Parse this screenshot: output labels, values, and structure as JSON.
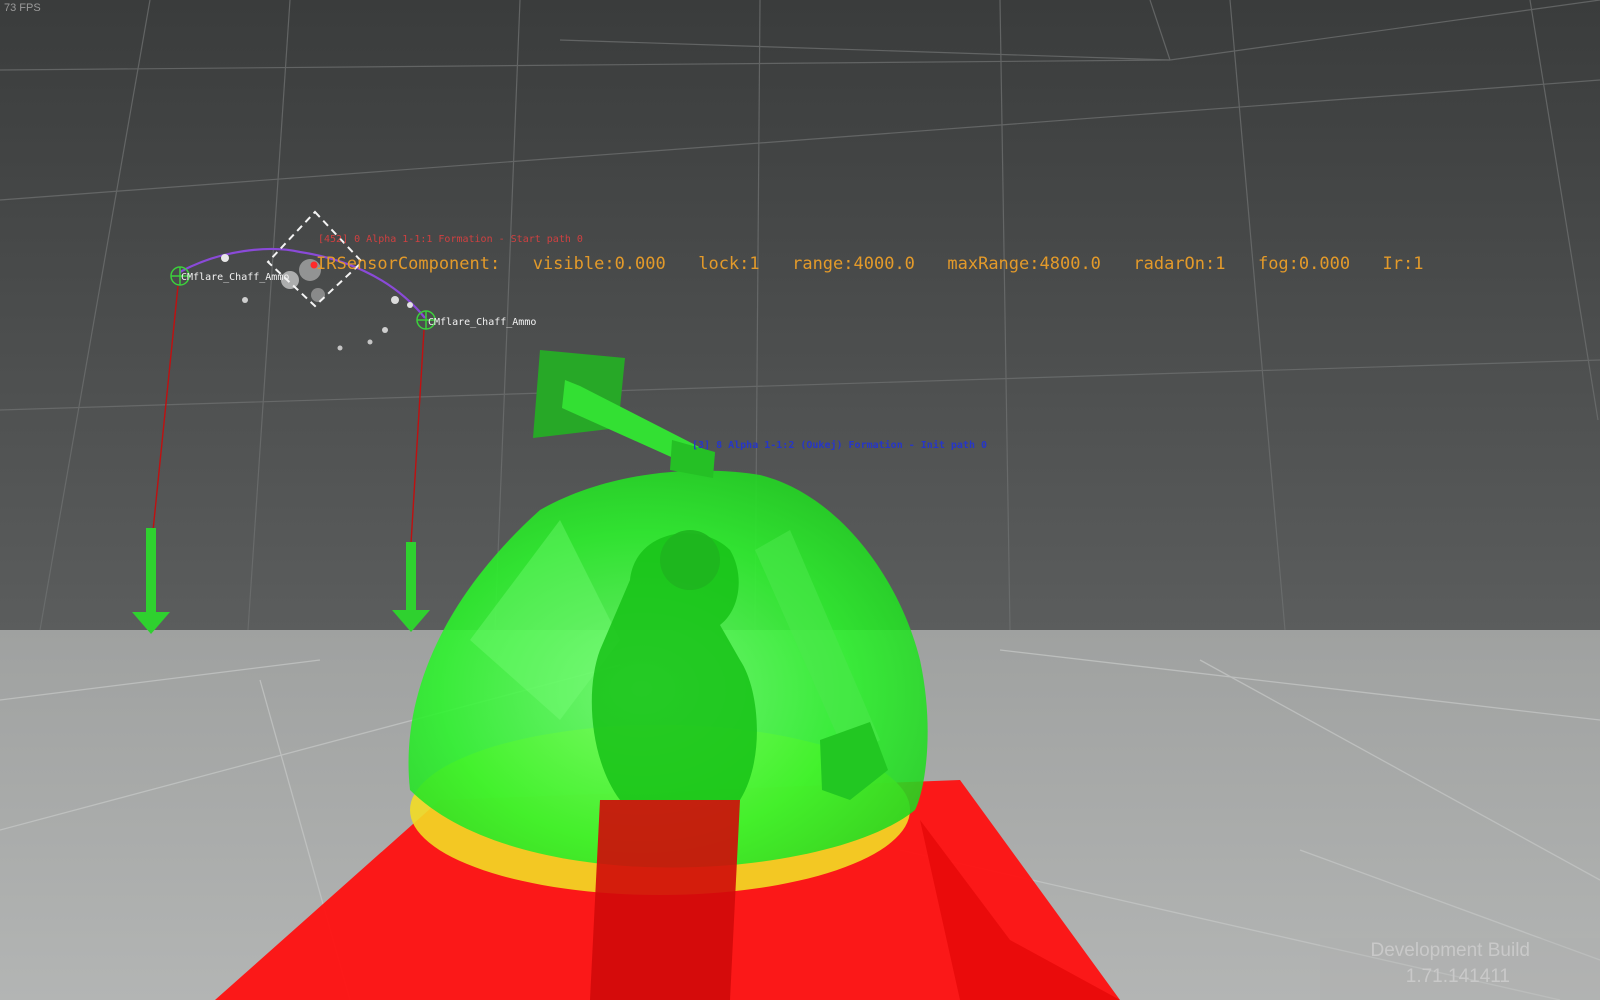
{
  "hud": {
    "fps": "73 FPS"
  },
  "debug": {
    "red_line": "[452] 0 Alpha 1-1:1 Formation - Start path 0",
    "sensor_line": "IRSensorComponent:  visible:0.000  lock:1  range:4000.0  maxRange:4800.0  radarOn:1  fog:0.000  Ir:1",
    "blue_line": "[3] 8 Alpha 1-1:2 (Oukej) Formation - Init path 0"
  },
  "entities": [
    {
      "label": "CMflare_Chaff_Ammo"
    },
    {
      "label": "CMflare_Chaff_Ammo"
    }
  ],
  "build": {
    "title": "Development Build",
    "version": "1.71.141411"
  },
  "colors": {
    "sky_top": "#3a3c3c",
    "sky_bottom": "#5b5d5d",
    "floor": "#a7a9a8",
    "dome_green": "#2cf52c",
    "dome_yellow": "#f2dc25",
    "base_red": "#ff1010",
    "arrow_green": "#2fd12f",
    "sensor_text": "#e39a2a",
    "debug_red": "#d04040",
    "debug_blue": "#2636c8"
  }
}
